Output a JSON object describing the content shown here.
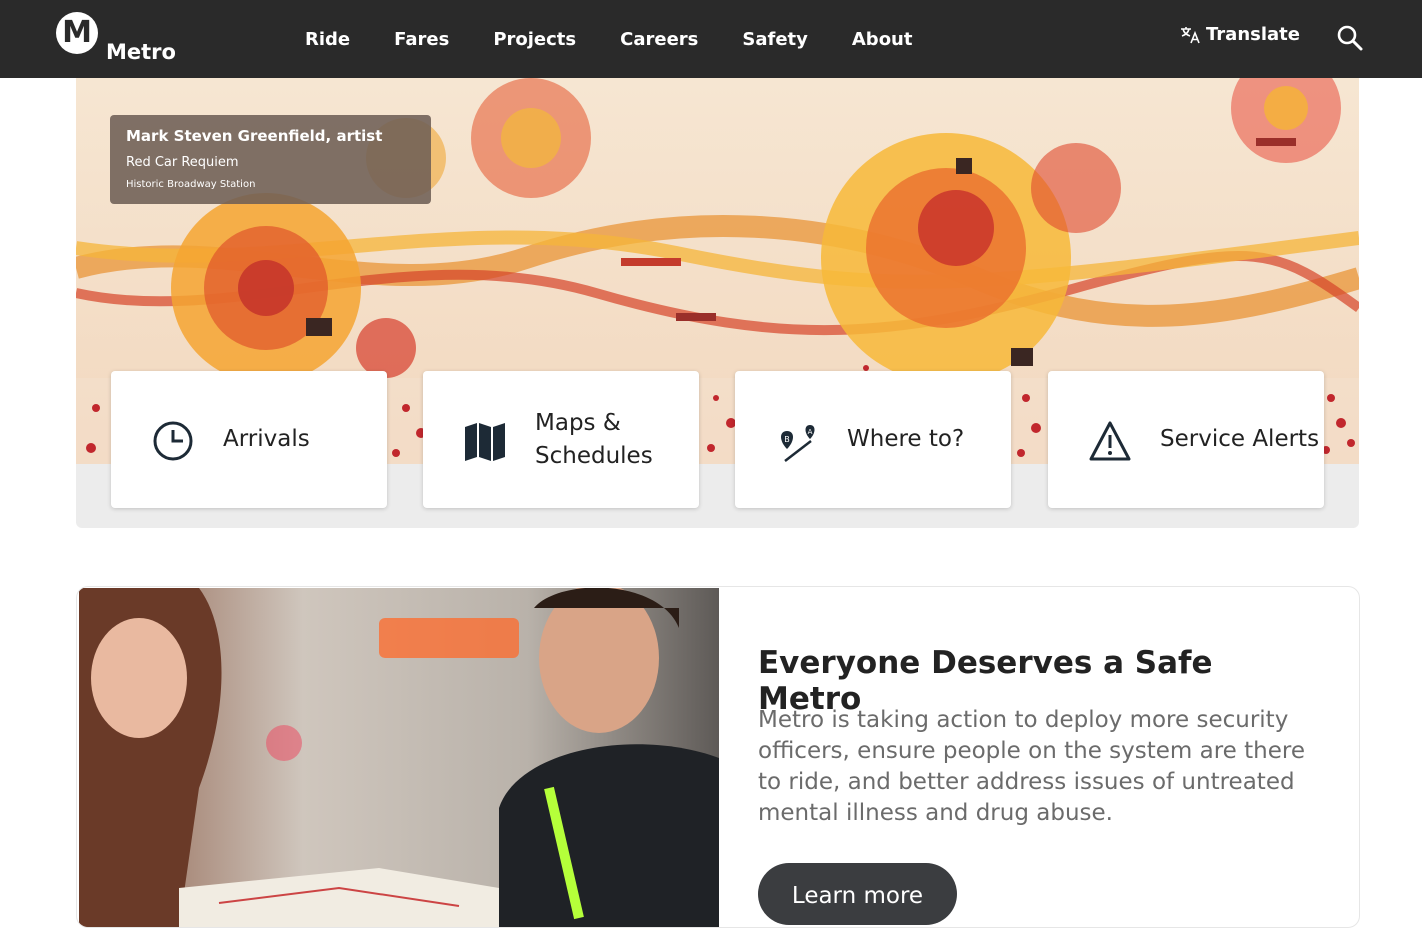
{
  "brand": {
    "logo_letter": "M",
    "name": "Metro"
  },
  "nav": {
    "links": [
      "Ride",
      "Fares",
      "Projects",
      "Careers",
      "Safety",
      "About"
    ],
    "translate_label": "Translate"
  },
  "hero": {
    "caption": {
      "artist": "Mark Steven Greenfield, artist",
      "title": "Red Car Requiem",
      "station": "Historic Broadway Station"
    },
    "cards": [
      {
        "label": "Arrivals",
        "icon": "clock-icon"
      },
      {
        "label_line1": "Maps &",
        "label_line2": "Schedules",
        "icon": "map-icon"
      },
      {
        "label": "Where to?",
        "icon": "route-pins-icon",
        "pin_a": "A",
        "pin_b": "B"
      },
      {
        "label": "Service Alerts",
        "icon": "warning-icon"
      }
    ]
  },
  "feature": {
    "heading": "Everyone Deserves a Safe Metro",
    "body": "Metro is taking action to deploy more security officers, ensure people on the system are there to ride, and better address issues of untreated mental illness and drug abuse.",
    "button_label": "Learn more"
  },
  "colors": {
    "header_bg": "#2a2a2a",
    "button_bg": "#3b3d40",
    "accent_orange": "#f08a24"
  }
}
